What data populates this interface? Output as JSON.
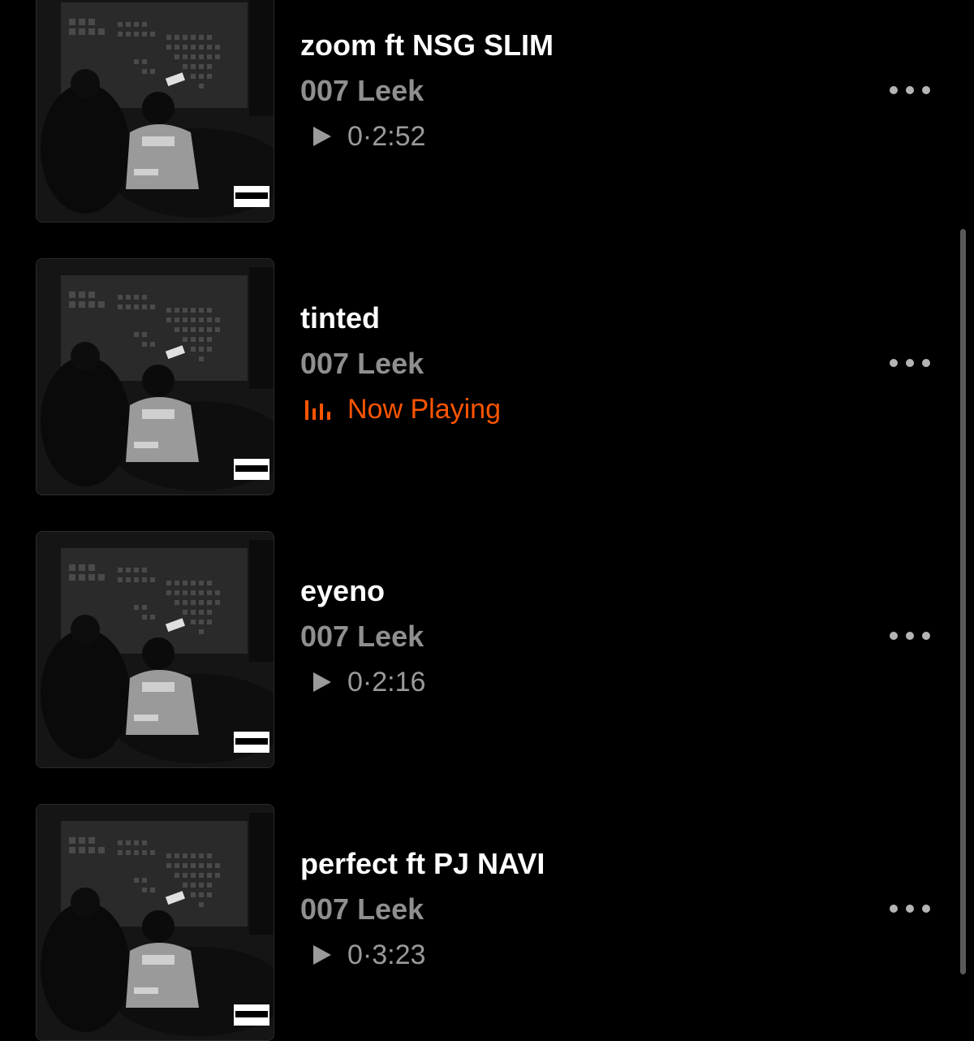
{
  "accent_color": "#ff5500",
  "tracks": [
    {
      "title": "zoom ft NSG SLIM",
      "artist": "007 Leek",
      "status_type": "plays",
      "plays": "0·2:52",
      "artwork": "album-cover-image",
      "badge": "PARENTAL ADVISORY EXPLICIT CONTENT"
    },
    {
      "title": "tinted",
      "artist": "007 Leek",
      "status_type": "now_playing",
      "now_playing": "Now Playing",
      "artwork": "album-cover-image",
      "badge": "PARENTAL ADVISORY EXPLICIT CONTENT"
    },
    {
      "title": "eyeno",
      "artist": "007 Leek",
      "status_type": "plays",
      "plays": "0·2:16",
      "artwork": "album-cover-image",
      "badge": "PARENTAL ADVISORY EXPLICIT CONTENT"
    },
    {
      "title": "perfect ft PJ NAVI",
      "artist": "007 Leek",
      "status_type": "plays",
      "plays": "0·3:23",
      "artwork": "album-cover-image",
      "badge": "PARENTAL ADVISORY EXPLICIT CONTENT"
    }
  ],
  "icons": {
    "play": "play-icon",
    "equalizer": "equalizer-icon",
    "more": "more-options-icon"
  }
}
